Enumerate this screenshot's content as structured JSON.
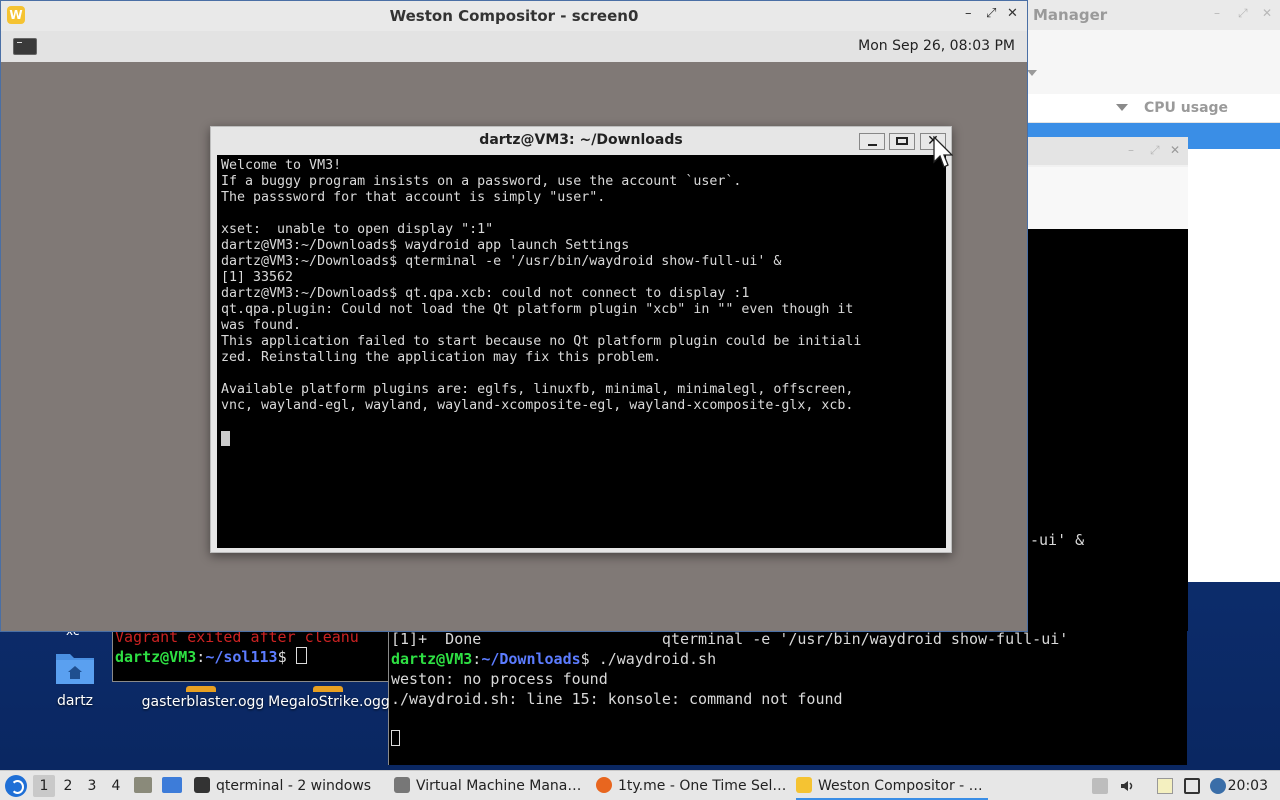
{
  "task_manager": {
    "title": "Manager",
    "column_cpu": "CPU usage"
  },
  "bg_terminal": {
    "fragment": "-ui' &"
  },
  "bottom_left_terminal": {
    "line1": "Vagrant exited after cleanu",
    "prompt_user": "dartz@VM3",
    "prompt_path": "~/sol113",
    "prompt_suffix": "$ "
  },
  "bottom_terminal": {
    "line1": "[1]+  Done                    qterminal -e '/usr/bin/waydroid show-full-ui'",
    "prompt_user": "dartz@VM3",
    "prompt_path": "~/Downloads",
    "command": "$ ./waydroid.sh",
    "line3": "weston: no process found",
    "line4": "./waydroid.sh: line 15: konsole: command not found"
  },
  "desktop": {
    "xc_label": "xc",
    "icons": [
      {
        "label": "dartz"
      },
      {
        "label": "gasterblaster.ogg"
      },
      {
        "label": "MegaloStrike.ogg"
      }
    ]
  },
  "weston": {
    "title": "Weston Compositor - screen0",
    "logo": "W",
    "clock": "Mon Sep 26, 08:03 PM",
    "controls": {
      "minimize": "–",
      "restore": "⤢",
      "close": "✕"
    }
  },
  "qterminal": {
    "title": "dartz@VM3: ~/Downloads",
    "close_glyph": "✕",
    "lines": [
      "Welcome to VM3!",
      "If a buggy program insists on a password, use the account `user`.",
      "The passsword for that account is simply \"user\".",
      "",
      "xset:  unable to open display \":1\"",
      "dartz@VM3:~/Downloads$ waydroid app launch Settings",
      "dartz@VM3:~/Downloads$ qterminal -e '/usr/bin/waydroid show-full-ui' &",
      "[1] 33562",
      "dartz@VM3:~/Downloads$ qt.qpa.xcb: could not connect to display :1",
      "qt.qpa.plugin: Could not load the Qt platform plugin \"xcb\" in \"\" even though it",
      "was found.",
      "This application failed to start because no Qt platform plugin could be initiali",
      "zed. Reinstalling the application may fix this problem.",
      "",
      "Available platform plugins are: eglfs, linuxfb, minimal, minimalegl, offscreen,",
      "vnc, wayland-egl, wayland, wayland-xcomposite-egl, wayland-xcomposite-glx, xcb."
    ]
  },
  "taskbar": {
    "workspaces": [
      "1",
      "2",
      "3",
      "4"
    ],
    "tasks": [
      {
        "label": "qterminal - 2 windows",
        "icon": "terminal-icon",
        "color": "#333333"
      },
      {
        "label": "Virtual Machine Mana…",
        "icon": "virt-manager-icon",
        "color": "#666666"
      },
      {
        "label": "1ty.me - One Time Sel…",
        "icon": "firefox-icon",
        "color": "#e8661f"
      },
      {
        "label": "Weston Compositor - …",
        "icon": "weston-icon",
        "color": "#f5c332"
      }
    ],
    "clock": "20:03"
  }
}
